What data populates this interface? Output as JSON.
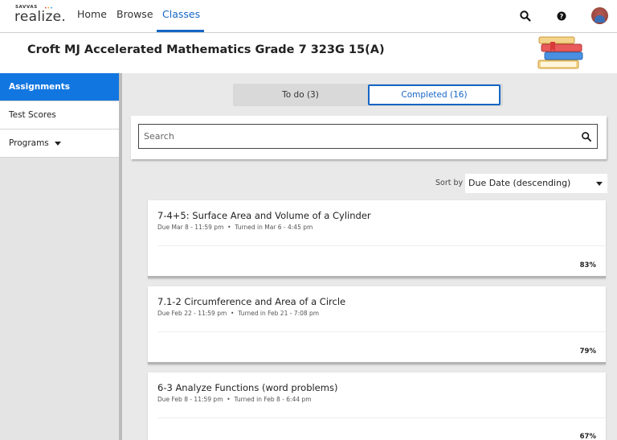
{
  "topnav": {
    "logo_small": "SAVVAS",
    "logo_text": "realize.",
    "home": "Home",
    "browse": "Browse",
    "classes": "Classes"
  },
  "header": {
    "class_title": "Croft MJ Accelerated Mathematics Grade 7 323G 15(A)"
  },
  "sidebar": {
    "items": [
      {
        "label": "Assignments"
      },
      {
        "label": "Test Scores"
      },
      {
        "label": "Programs"
      }
    ]
  },
  "tabs": {
    "todo": "To do (3)",
    "completed": "Completed (16)"
  },
  "search": {
    "placeholder": "Search"
  },
  "sort": {
    "label": "Sort by",
    "value": "Due Date (descending)"
  },
  "assignments": [
    {
      "title": "7-4+5: Surface Area and Volume of a Cylinder",
      "due": "Due Mar 8 - 11:59 pm",
      "turned_in": "Turned in Mar 6 - 4:45 pm",
      "score": "83%"
    },
    {
      "title": "7.1-2 Circumference and Area of a Circle",
      "due": "Due Feb 22 - 11:59 pm",
      "turned_in": "Turned in Feb 21 - 7:08 pm",
      "score": "79%"
    },
    {
      "title": "6-3 Analyze Functions (word problems)",
      "due": "Due Feb 8 - 11:59 pm",
      "turned_in": "Turned in Feb 8 - 6:44 pm",
      "score": "67%"
    }
  ],
  "colors": {
    "accent": "#1666c5",
    "sidebar_active": "#1276e0"
  }
}
